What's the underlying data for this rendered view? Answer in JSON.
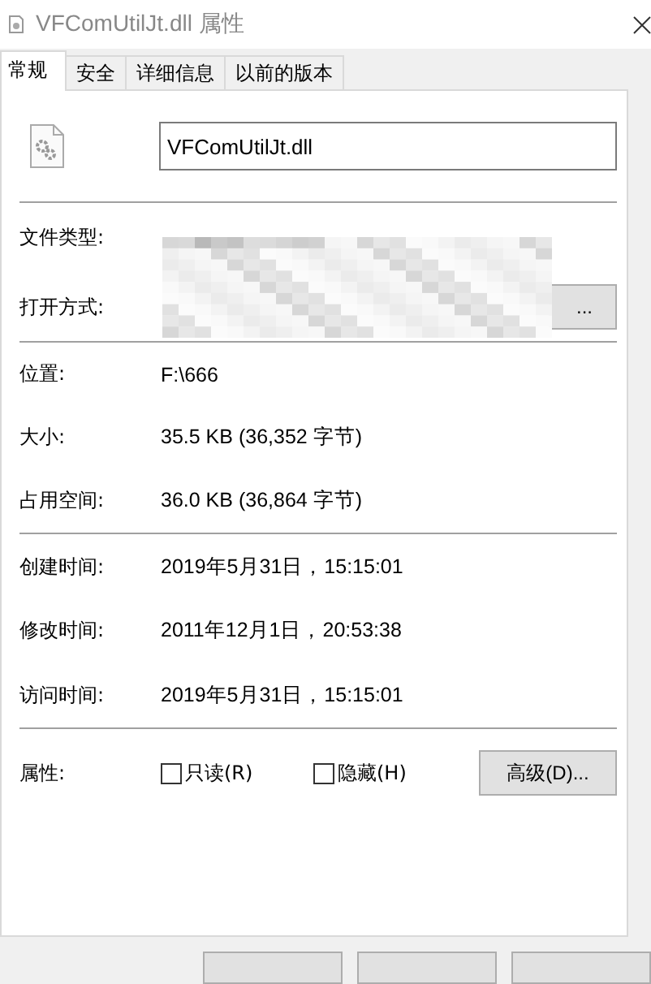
{
  "window": {
    "title": "VFComUtilJt.dll 属性"
  },
  "tabs": [
    {
      "label": "常规",
      "selected": true
    },
    {
      "label": "安全",
      "selected": false
    },
    {
      "label": "详细信息",
      "selected": false
    },
    {
      "label": "以前的版本",
      "selected": false
    }
  ],
  "file_name": "VFComUtilJt.dll",
  "type_rows": [
    {
      "label": "文件类型:"
    },
    {
      "label": "打开方式:",
      "button": "..."
    }
  ],
  "location_rows": [
    {
      "label": "位置:",
      "value": "F:\\666"
    },
    {
      "label": "大小:",
      "value": "35.5 KB (36,352 字节)"
    },
    {
      "label": "占用空间:",
      "value": "36.0 KB (36,864 字节)"
    }
  ],
  "time_rows": [
    {
      "label": "创建时间:",
      "value": "2019年5月31日，15:15:01"
    },
    {
      "label": "修改时间:",
      "value": "2011年12月1日，20:53:38"
    },
    {
      "label": "访问时间:",
      "value": "2019年5月31日，15:15:01"
    }
  ],
  "attributes": {
    "label": "属性:",
    "checkboxes": [
      {
        "label": "只读(R)",
        "checked": false
      },
      {
        "label": "隐藏(H)",
        "checked": false
      }
    ],
    "button": "高级(D)..."
  }
}
